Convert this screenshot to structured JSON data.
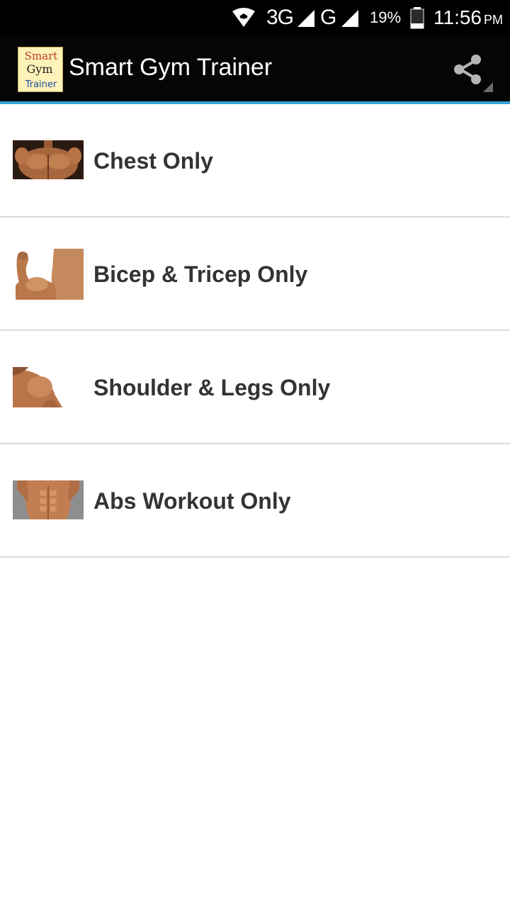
{
  "status_bar": {
    "network_3g": "3G",
    "network_g": "G",
    "battery_percent": "19%",
    "time": "11:56",
    "ampm": "PM",
    "icons": [
      "wifi-icon",
      "signal-icon",
      "signal-icon",
      "battery-icon"
    ]
  },
  "action_bar": {
    "title": "Smart Gym Trainer",
    "logo_lines": [
      "Smart",
      "Gym",
      "Trainer"
    ],
    "share_icon": "share-icon",
    "accent_color": "#35a4d8"
  },
  "workouts": [
    {
      "label": "Chest Only",
      "thumb_icon": "chest-thumbnail"
    },
    {
      "label": "Bicep & Tricep Only",
      "thumb_icon": "bicep-thumbnail"
    },
    {
      "label": "Shoulder & Legs Only",
      "thumb_icon": "shoulder-thumbnail"
    },
    {
      "label": "Abs Workout Only",
      "thumb_icon": "abs-thumbnail"
    }
  ]
}
